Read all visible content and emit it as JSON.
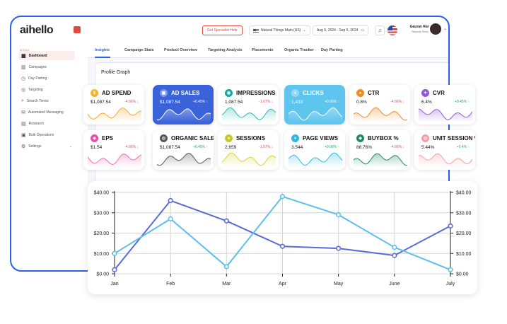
{
  "app": {
    "logo": "aihello",
    "specialist_button": "Get Specialist Help",
    "marketplace": "Natural Things Main (US)",
    "date_range": "Aug 6, 2024 - Sep 5, 2024",
    "user_name": "Gaurav Rai",
    "user_role": "Natural Store"
  },
  "sidebar": {
    "menu_title": "MENU",
    "items": [
      {
        "label": "Dashboard",
        "active": true,
        "icon": "dashboard-icon"
      },
      {
        "label": "Campaigns",
        "active": false,
        "icon": "campaigns-icon"
      },
      {
        "label": "Day Parting",
        "active": false,
        "icon": "clock-icon"
      },
      {
        "label": "Targeting",
        "active": false,
        "icon": "target-icon"
      },
      {
        "label": "Search Terms",
        "active": false,
        "icon": "search-icon"
      },
      {
        "label": "Automated Messaging",
        "active": false,
        "icon": "message-icon"
      },
      {
        "label": "Research",
        "active": false,
        "icon": "research-icon"
      },
      {
        "label": "Bulk Operations",
        "active": false,
        "icon": "bulk-icon"
      },
      {
        "label": "Settings",
        "active": false,
        "icon": "gear-icon"
      }
    ]
  },
  "tabs": [
    "Insights",
    "Campaign Stats",
    "Product Overview",
    "Targeting Analysis",
    "Placements",
    "Organic Tracker",
    "Day Parting"
  ],
  "profile_title": "Profile Graph",
  "metrics": [
    {
      "title": "AD SPEND",
      "value": "$1,087.54",
      "change": "-4.66% ↓",
      "dir": "down",
      "style": "white",
      "icon_color": "#f0b429",
      "spark_color": "#f6a935"
    },
    {
      "title": "AD SALES",
      "value": "$1,087.54",
      "change": "+0.45% ↑",
      "dir": "up",
      "style": "blue",
      "icon_color": "#ffffff",
      "spark_color": "#ffffff"
    },
    {
      "title": "IMPRESSIONS",
      "value": "1,087.54",
      "change": "-1.07% ↓",
      "dir": "down",
      "style": "white",
      "icon_color": "#1aa7a1",
      "spark_color": "#2bb9b2"
    },
    {
      "title": "CLICKS",
      "value": "1,433",
      "change": "+0.06% ↑",
      "dir": "up",
      "style": "lightblue",
      "icon_color": "#ffffff",
      "spark_color": "#ffffff"
    },
    {
      "title": "CTR",
      "value": "0.8%",
      "change": "-4.66% ↓",
      "dir": "down",
      "style": "white",
      "icon_color": "#f08a24",
      "spark_color": "#f08a24"
    },
    {
      "title": "CVR",
      "value": "6.4%",
      "change": "+0.45% ↑",
      "dir": "up",
      "style": "white",
      "icon_color": "#8e5bd6",
      "spark_color": "#8e5bd6"
    },
    {
      "title": "EPS",
      "value": "$1.54",
      "change": "-4.66% ↓",
      "dir": "down",
      "style": "white",
      "icon_color": "#e84fa3",
      "spark_color": "#ef6fb5"
    },
    {
      "title": "ORGANIC SALES",
      "value": "$1,087.54",
      "change": "+0.45% ↑",
      "dir": "up",
      "style": "white",
      "icon_color": "#555555",
      "spark_color": "#555555"
    },
    {
      "title": "SESSIONS",
      "value": "2,659",
      "change": "-1.57% ↓",
      "dir": "down",
      "style": "white",
      "icon_color": "#c9c82a",
      "spark_color": "#d5d43a"
    },
    {
      "title": "PAGE VIEWS",
      "value": "3.544",
      "change": "+0.08% ↑",
      "dir": "up",
      "style": "white",
      "icon_color": "#31b8e0",
      "spark_color": "#31b8e0"
    },
    {
      "title": "BUYBOX %",
      "value": "88.76%",
      "change": "-4.66% ↓",
      "dir": "down",
      "style": "white",
      "icon_color": "#1e8a5e",
      "spark_color": "#1e8a5e"
    },
    {
      "title": "UNIT SESSION %",
      "value": "5.44%",
      "change": "+0.4% ↑",
      "dir": "up",
      "style": "white",
      "icon_color": "#f2a0a8",
      "spark_color": "#f2a0a8"
    }
  ],
  "chart_data": {
    "type": "line",
    "categories": [
      "Jan",
      "Feb",
      "Mar",
      "Apr",
      "May",
      "June",
      "July"
    ],
    "y_ticks": [
      "$0.00",
      "$10.00",
      "$20.00",
      "$30.00",
      "$40.00"
    ],
    "ylim": [
      0,
      40
    ],
    "grid": true,
    "dual_axis": true,
    "series": [
      {
        "color": "#5a6ad6",
        "values": [
          2,
          36,
          26,
          13.5,
          12.5,
          9,
          23.5
        ]
      },
      {
        "color": "#5bbfee",
        "values": [
          10,
          27,
          3.5,
          38,
          29,
          13,
          2
        ]
      }
    ]
  },
  "colors": {
    "accent": "#2d5fe8",
    "brand_red": "#e14b3b",
    "positive": "#1aa77a",
    "negative": "#e14b6b"
  }
}
